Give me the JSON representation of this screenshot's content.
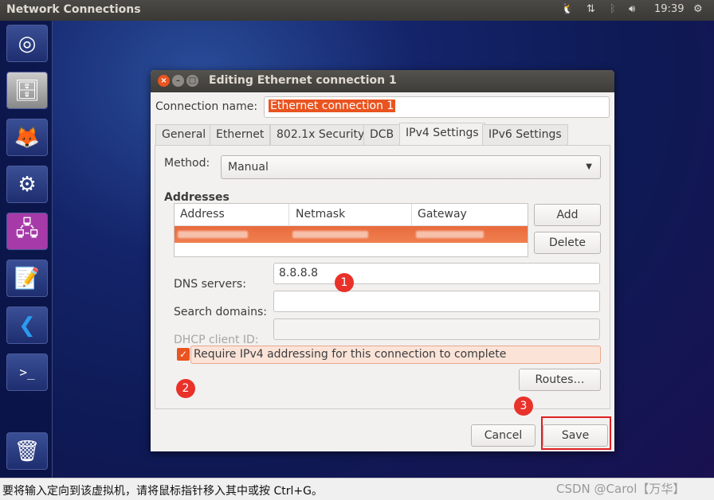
{
  "topbar": {
    "title": "Network Connections",
    "clock": "19:39",
    "icons": [
      "tux-icon",
      "network-updown-icon",
      "bluetooth-icon",
      "volume-icon",
      "power-gear-icon"
    ]
  },
  "launcher": {
    "items": [
      "ubuntu-dash",
      "file-manager",
      "firefox",
      "system-settings",
      "network-connections",
      "text-editor",
      "vscode",
      "terminal",
      "trash"
    ]
  },
  "dialog": {
    "title": "Editing Ethernet connection 1",
    "connection_name_label": "Connection name:",
    "connection_name_value": "Ethernet connection 1",
    "tabs": [
      {
        "label": "General"
      },
      {
        "label": "Ethernet"
      },
      {
        "label": "802.1x Security"
      },
      {
        "label": "DCB"
      },
      {
        "label": "IPv4 Settings",
        "active": true
      },
      {
        "label": "IPv6 Settings"
      }
    ],
    "method_label": "Method:",
    "method_value": "Manual",
    "addresses_heading": "Addresses",
    "table": {
      "columns": [
        "Address",
        "Netmask",
        "Gateway"
      ]
    },
    "add_label": "Add",
    "delete_label": "Delete",
    "dns_label": "DNS servers:",
    "dns_value": "8.8.8.8",
    "search_label": "Search domains:",
    "search_value": "",
    "dhcp_label": "DHCP client ID:",
    "dhcp_value": "",
    "require_label": "Require IPv4 addressing for this connection to complete",
    "require_checked": true,
    "routes_label": "Routes…",
    "cancel_label": "Cancel",
    "save_label": "Save"
  },
  "annotations": [
    "1",
    "2",
    "3"
  ],
  "status": {
    "text": "要将输入定向到该虚拟机，请将鼠标指针移入其中或按 Ctrl+G。",
    "watermark": "CSDN @Carol【万华】"
  },
  "colors": {
    "accent": "#e95420",
    "annotation": "#e8322a",
    "highlight_box": "#e02020"
  }
}
